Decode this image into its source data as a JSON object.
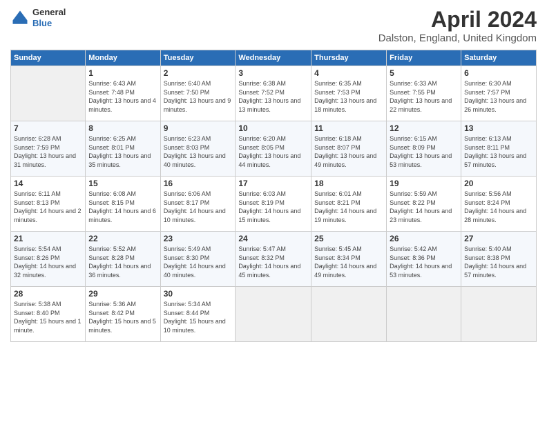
{
  "header": {
    "logo_line1": "General",
    "logo_line2": "Blue",
    "main_title": "April 2024",
    "subtitle": "Dalston, England, United Kingdom"
  },
  "calendar": {
    "days": [
      "Sunday",
      "Monday",
      "Tuesday",
      "Wednesday",
      "Thursday",
      "Friday",
      "Saturday"
    ],
    "weeks": [
      [
        {
          "num": "",
          "empty": true
        },
        {
          "num": "1",
          "rise": "6:43 AM",
          "set": "7:48 PM",
          "daylight": "13 hours and 4 minutes."
        },
        {
          "num": "2",
          "rise": "6:40 AM",
          "set": "7:50 PM",
          "daylight": "13 hours and 9 minutes."
        },
        {
          "num": "3",
          "rise": "6:38 AM",
          "set": "7:52 PM",
          "daylight": "13 hours and 13 minutes."
        },
        {
          "num": "4",
          "rise": "6:35 AM",
          "set": "7:53 PM",
          "daylight": "13 hours and 18 minutes."
        },
        {
          "num": "5",
          "rise": "6:33 AM",
          "set": "7:55 PM",
          "daylight": "13 hours and 22 minutes."
        },
        {
          "num": "6",
          "rise": "6:30 AM",
          "set": "7:57 PM",
          "daylight": "13 hours and 26 minutes."
        }
      ],
      [
        {
          "num": "7",
          "rise": "6:28 AM",
          "set": "7:59 PM",
          "daylight": "13 hours and 31 minutes."
        },
        {
          "num": "8",
          "rise": "6:25 AM",
          "set": "8:01 PM",
          "daylight": "13 hours and 35 minutes."
        },
        {
          "num": "9",
          "rise": "6:23 AM",
          "set": "8:03 PM",
          "daylight": "13 hours and 40 minutes."
        },
        {
          "num": "10",
          "rise": "6:20 AM",
          "set": "8:05 PM",
          "daylight": "13 hours and 44 minutes."
        },
        {
          "num": "11",
          "rise": "6:18 AM",
          "set": "8:07 PM",
          "daylight": "13 hours and 49 minutes."
        },
        {
          "num": "12",
          "rise": "6:15 AM",
          "set": "8:09 PM",
          "daylight": "13 hours and 53 minutes."
        },
        {
          "num": "13",
          "rise": "6:13 AM",
          "set": "8:11 PM",
          "daylight": "13 hours and 57 minutes."
        }
      ],
      [
        {
          "num": "14",
          "rise": "6:11 AM",
          "set": "8:13 PM",
          "daylight": "14 hours and 2 minutes."
        },
        {
          "num": "15",
          "rise": "6:08 AM",
          "set": "8:15 PM",
          "daylight": "14 hours and 6 minutes."
        },
        {
          "num": "16",
          "rise": "6:06 AM",
          "set": "8:17 PM",
          "daylight": "14 hours and 10 minutes."
        },
        {
          "num": "17",
          "rise": "6:03 AM",
          "set": "8:19 PM",
          "daylight": "14 hours and 15 minutes."
        },
        {
          "num": "18",
          "rise": "6:01 AM",
          "set": "8:21 PM",
          "daylight": "14 hours and 19 minutes."
        },
        {
          "num": "19",
          "rise": "5:59 AM",
          "set": "8:22 PM",
          "daylight": "14 hours and 23 minutes."
        },
        {
          "num": "20",
          "rise": "5:56 AM",
          "set": "8:24 PM",
          "daylight": "14 hours and 28 minutes."
        }
      ],
      [
        {
          "num": "21",
          "rise": "5:54 AM",
          "set": "8:26 PM",
          "daylight": "14 hours and 32 minutes."
        },
        {
          "num": "22",
          "rise": "5:52 AM",
          "set": "8:28 PM",
          "daylight": "14 hours and 36 minutes."
        },
        {
          "num": "23",
          "rise": "5:49 AM",
          "set": "8:30 PM",
          "daylight": "14 hours and 40 minutes."
        },
        {
          "num": "24",
          "rise": "5:47 AM",
          "set": "8:32 PM",
          "daylight": "14 hours and 45 minutes."
        },
        {
          "num": "25",
          "rise": "5:45 AM",
          "set": "8:34 PM",
          "daylight": "14 hours and 49 minutes."
        },
        {
          "num": "26",
          "rise": "5:42 AM",
          "set": "8:36 PM",
          "daylight": "14 hours and 53 minutes."
        },
        {
          "num": "27",
          "rise": "5:40 AM",
          "set": "8:38 PM",
          "daylight": "14 hours and 57 minutes."
        }
      ],
      [
        {
          "num": "28",
          "rise": "5:38 AM",
          "set": "8:40 PM",
          "daylight": "15 hours and 1 minute."
        },
        {
          "num": "29",
          "rise": "5:36 AM",
          "set": "8:42 PM",
          "daylight": "15 hours and 5 minutes."
        },
        {
          "num": "30",
          "rise": "5:34 AM",
          "set": "8:44 PM",
          "daylight": "15 hours and 10 minutes."
        },
        {
          "num": "",
          "empty": true
        },
        {
          "num": "",
          "empty": true
        },
        {
          "num": "",
          "empty": true
        },
        {
          "num": "",
          "empty": true
        }
      ]
    ]
  },
  "labels": {
    "sunrise": "Sunrise:",
    "sunset": "Sunset:",
    "daylight": "Daylight:"
  }
}
